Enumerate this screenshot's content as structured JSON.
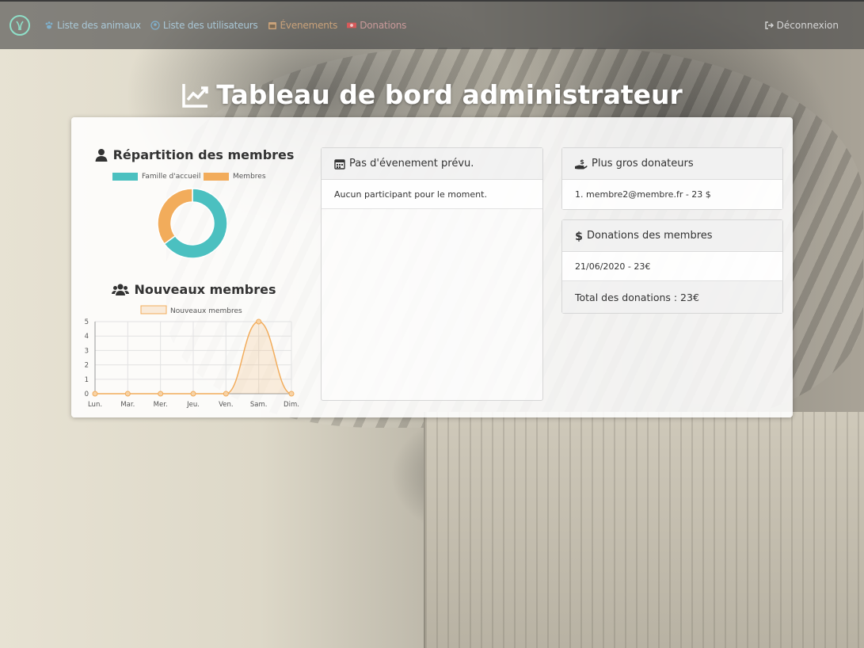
{
  "navbar": {
    "items": [
      {
        "label": "Liste des animaux"
      },
      {
        "label": "Liste des utilisateurs"
      },
      {
        "label": "Évenements"
      },
      {
        "label": "Donations"
      }
    ],
    "logout_label": "Déconnexion"
  },
  "page": {
    "title": "Tableau de bord administrateur"
  },
  "left": {
    "members_title": "Répartition des membres",
    "new_members_title": "Nouveaux membres"
  },
  "events_panel": {
    "title": "Pas d'évenement prévu.",
    "row": "Aucun participant pour le moment."
  },
  "donors_panel": {
    "title": "Plus gros donateurs",
    "rows": [
      "1. membre2@membre.fr - 23 $"
    ]
  },
  "donations_panel": {
    "title": "Donations des membres",
    "rows": [
      "21/06/2020 - 23€"
    ],
    "total": "Total des donations : 23€"
  },
  "colors": {
    "teal": "#4bc0c0",
    "orange": "#f2ac5b"
  },
  "chart_data": [
    {
      "type": "pie",
      "title": "",
      "categories": [
        "Famille d'accueil",
        "Membres"
      ],
      "values": [
        65,
        35
      ],
      "colors": [
        "#4bc0c0",
        "#f2ac5b"
      ],
      "legend": "top"
    },
    {
      "type": "area",
      "title": "",
      "x": [
        "Lun.",
        "Mar.",
        "Mer.",
        "Jeu.",
        "Ven.",
        "Sam.",
        "Dim."
      ],
      "series": [
        {
          "name": "Nouveaux membres",
          "values": [
            0,
            0,
            0,
            0,
            0,
            5,
            0
          ]
        }
      ],
      "ylim": [
        0,
        5
      ],
      "yticks": [
        "0",
        "1",
        "2",
        "3",
        "4",
        "5"
      ],
      "grid": true,
      "legend": "top",
      "color": "#f2ac5b"
    }
  ]
}
